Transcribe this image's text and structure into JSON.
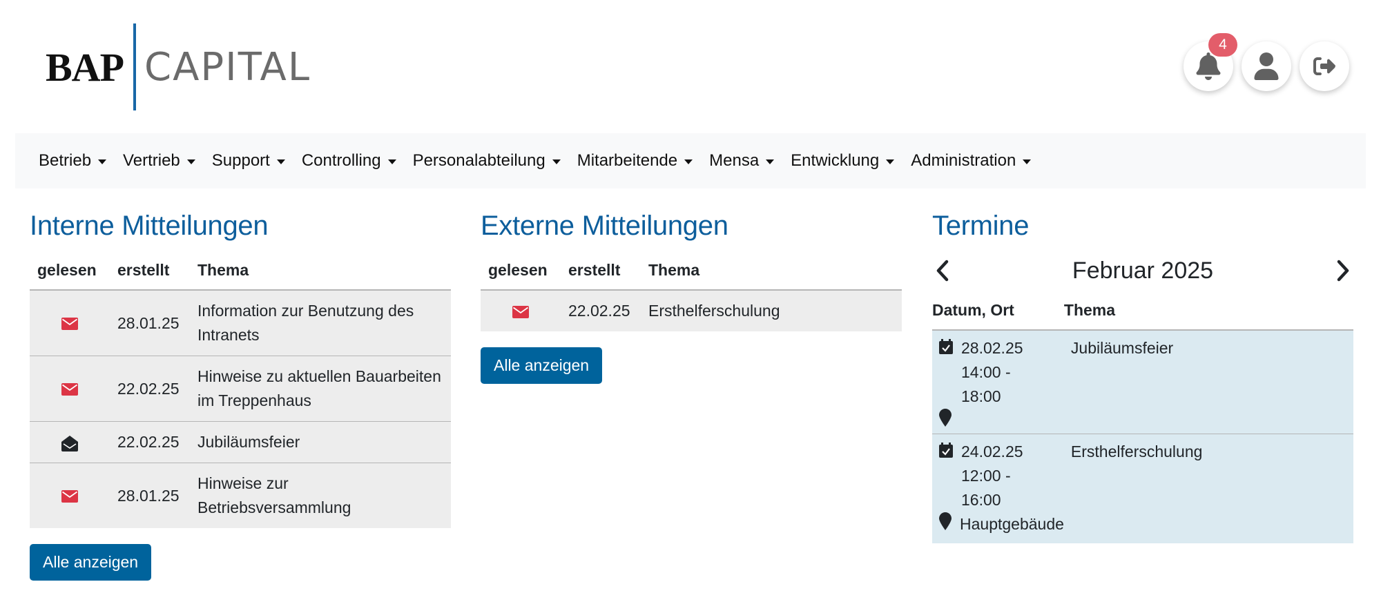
{
  "brand": {
    "bold": "BAP",
    "light": "CAPITAL",
    "accent_color": "#1867a7"
  },
  "top_actions": {
    "notifications_icon": "bell-icon",
    "notifications_count": "4",
    "profile_icon": "user-icon",
    "logout_icon": "sign-out-icon"
  },
  "nav": {
    "items": [
      {
        "label": "Betrieb"
      },
      {
        "label": "Vertrieb"
      },
      {
        "label": "Support"
      },
      {
        "label": "Controlling"
      },
      {
        "label": "Personalabteilung"
      },
      {
        "label": "Mitarbeitende"
      },
      {
        "label": "Mensa"
      },
      {
        "label": "Entwicklung"
      },
      {
        "label": "Administration"
      }
    ]
  },
  "internal": {
    "title": "Interne Mitteilungen",
    "columns": [
      "gelesen",
      "erstellt",
      "Thema"
    ],
    "rows": [
      {
        "read": false,
        "icon": "envelope-unread-icon",
        "date": "28.01.25",
        "topic": "Information zur Benutzung des Intranets"
      },
      {
        "read": false,
        "icon": "envelope-unread-icon",
        "date": "22.02.25",
        "topic": "Hinweise zu aktuellen Bauarbeiten im Treppenhaus"
      },
      {
        "read": true,
        "icon": "envelope-open-icon",
        "date": "22.02.25",
        "topic": "Jubiläumsfeier"
      },
      {
        "read": false,
        "icon": "envelope-unread-icon",
        "date": "28.01.25",
        "topic": "Hinweise zur Betriebsversammlung"
      }
    ],
    "button": "Alle anzeigen"
  },
  "external": {
    "title": "Externe Mitteilungen",
    "columns": [
      "gelesen",
      "erstellt",
      "Thema"
    ],
    "rows": [
      {
        "read": false,
        "icon": "envelope-unread-icon",
        "date": "22.02.25",
        "topic": "Ersthelferschulung"
      }
    ],
    "button": "Alle anzeigen"
  },
  "events": {
    "title": "Termine",
    "month": "Februar 2025",
    "columns": [
      "Datum, Ort",
      "Thema"
    ],
    "rows": [
      {
        "date": "28.02.25",
        "time_start": "14:00 -",
        "time_end": "18:00",
        "place": "",
        "topic": "Jubiläumsfeier"
      },
      {
        "date": "24.02.25",
        "time_start": "12:00 -",
        "time_end": "16:00",
        "place": "Hauptgebäude",
        "topic": "Ersthelferschulung"
      }
    ]
  },
  "colors": {
    "heading": "#0d5e9c",
    "button": "#00639c",
    "unread": "#dc3545",
    "badge": "#e35d6a",
    "event_bg": "#dbeaf1",
    "row_bg": "#ededed"
  }
}
